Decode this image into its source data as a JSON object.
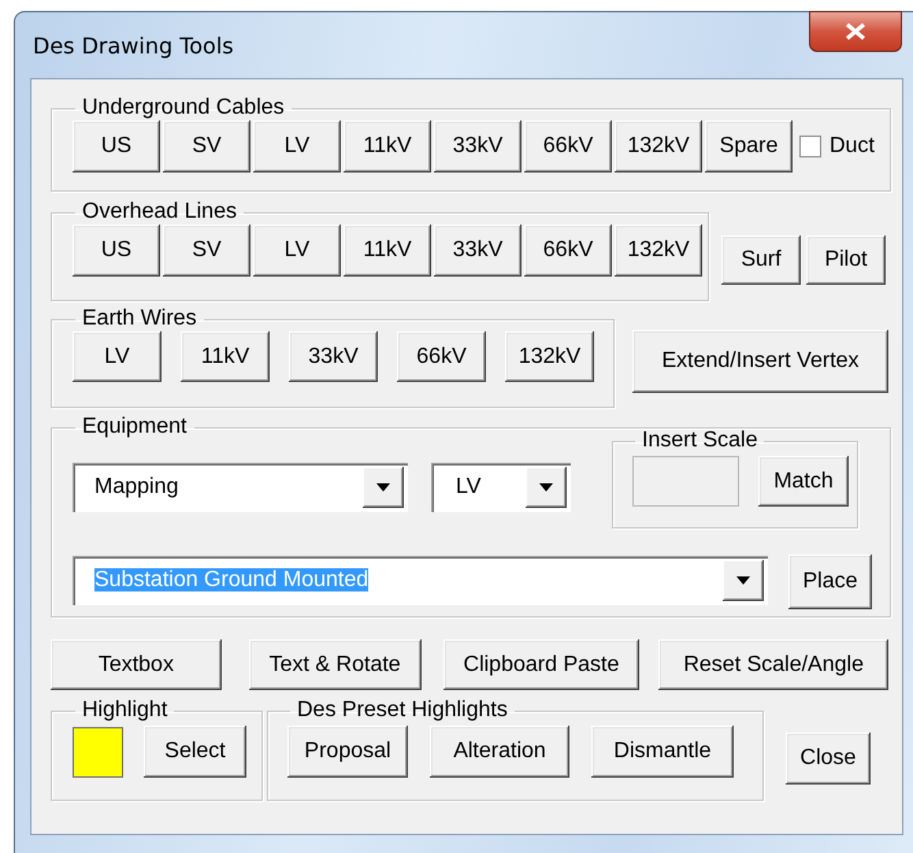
{
  "window": {
    "title": "Des Drawing Tools"
  },
  "underground_cables": {
    "label": "Underground Cables",
    "buttons": [
      "US",
      "SV",
      "LV",
      "11kV",
      "33kV",
      "66kV",
      "132kV",
      "Spare"
    ],
    "duct": {
      "label": "Duct",
      "checked": false
    }
  },
  "overhead_lines": {
    "label": "Overhead Lines",
    "buttons": [
      "US",
      "SV",
      "LV",
      "11kV",
      "33kV",
      "66kV",
      "132kV"
    ]
  },
  "overhead_side_buttons": [
    "Surf",
    "Pilot"
  ],
  "earth_wires": {
    "label": "Earth Wires",
    "buttons": [
      "LV",
      "11kV",
      "33kV",
      "66kV",
      "132kV"
    ]
  },
  "extend_button": "Extend/Insert Vertex",
  "equipment": {
    "label": "Equipment",
    "category": {
      "value": "Mapping"
    },
    "voltage": {
      "value": "LV"
    },
    "insert_scale": {
      "label": "Insert Scale",
      "button": "Match"
    },
    "item": {
      "value": "Substation Ground Mounted",
      "selected": true
    },
    "place_button": "Place"
  },
  "actions": [
    "Textbox",
    "Text & Rotate",
    "Clipboard Paste",
    "Reset Scale/Angle"
  ],
  "highlight": {
    "label": "Highlight",
    "color": "#ffff00",
    "button": "Select"
  },
  "preset_highlights": {
    "label": "Des Preset Highlights",
    "buttons": [
      "Proposal",
      "Alteration",
      "Dismantle"
    ]
  },
  "close_button": "Close"
}
